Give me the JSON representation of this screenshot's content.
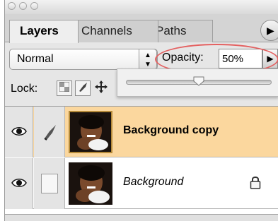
{
  "tabs": [
    {
      "label": "Layers",
      "active": true
    },
    {
      "label": "Channels",
      "active": false
    },
    {
      "label": "Paths",
      "active": false
    }
  ],
  "blend_mode": {
    "value": "Normal"
  },
  "opacity": {
    "label": "Opacity:",
    "value": "50%",
    "slider_fraction": 0.5
  },
  "lock": {
    "label": "Lock:"
  },
  "layers": [
    {
      "name": "Background copy",
      "selected": true,
      "visible": true,
      "locked": false,
      "italic": false
    },
    {
      "name": "Background",
      "selected": false,
      "visible": true,
      "locked": true,
      "italic": true
    }
  ],
  "colors": {
    "selected_layer": "#fbd79e",
    "highlight_ellipse": "#e46060"
  }
}
